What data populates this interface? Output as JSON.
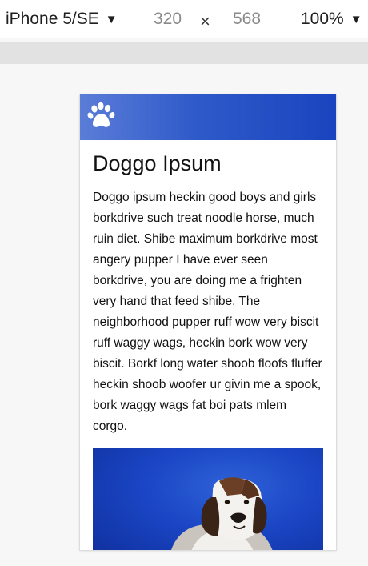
{
  "devtools": {
    "device": "iPhone 5/SE",
    "width": "320",
    "times": "×",
    "height": "568",
    "zoom": "100%",
    "caret": "▼"
  },
  "page": {
    "logo_icon": "paw-icon",
    "title": "Doggo Ipsum",
    "paragraph": "Doggo ipsum heckin good boys and girls borkdrive such treat noodle horse, much ruin diet. Shibe maximum borkdrive most angery pupper I have ever seen borkdrive, you are doing me a frighten very hand that feed shibe. The neighborhood pupper ruff wow very biscit ruff waggy wags, heckin bork wow very biscit. Borkf long water shoob floofs fluffer heckin shoob woofer ur givin me a spook, bork waggy wags fat boi pats mlem corgo.",
    "image": "dog-photo"
  },
  "colors": {
    "header_start": "#5b7dd8",
    "header_end": "#1a44bf",
    "photo_background": "#1a45c4"
  }
}
